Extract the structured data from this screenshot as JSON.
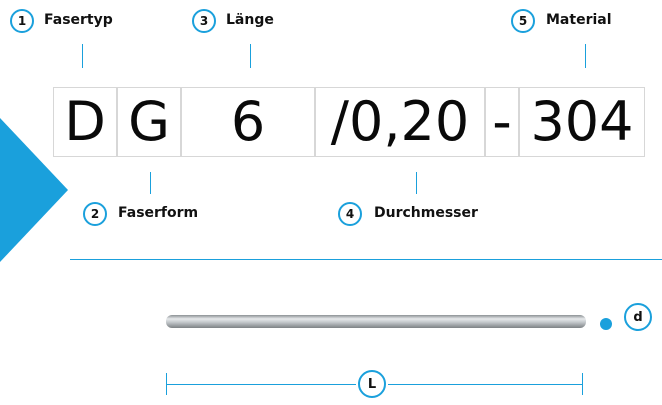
{
  "accent_color": "#1aa0dc",
  "code_segments": [
    "D",
    "G",
    "6",
    "/0,20",
    "-",
    "304"
  ],
  "callouts": [
    {
      "number": "1",
      "label": "Fasertyp"
    },
    {
      "number": "2",
      "label": "Faserform"
    },
    {
      "number": "3",
      "label": "Länge"
    },
    {
      "number": "4",
      "label": "Durchmesser"
    },
    {
      "number": "5",
      "label": "Material"
    }
  ],
  "dimension_labels": {
    "diameter": "d",
    "length": "L"
  }
}
